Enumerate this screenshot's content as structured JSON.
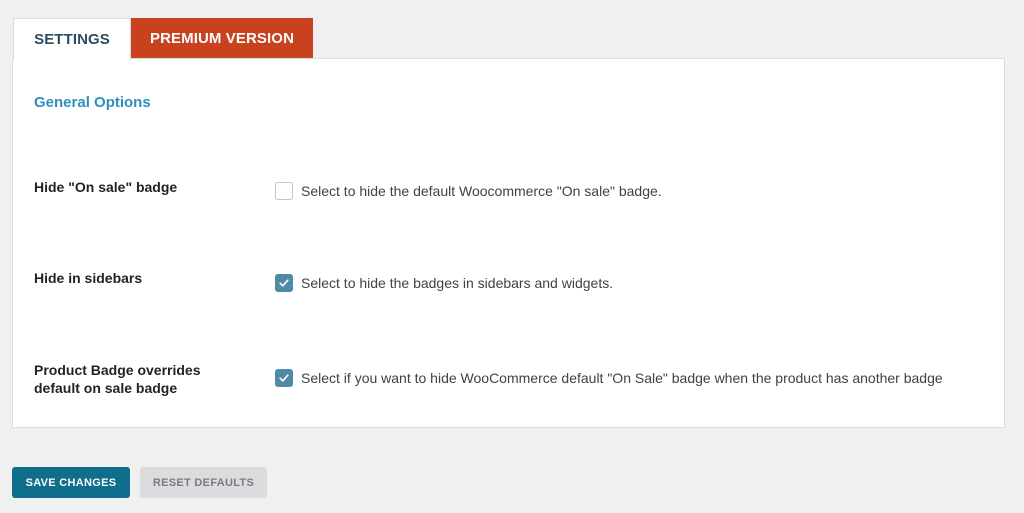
{
  "tabs": [
    {
      "label": "SETTINGS",
      "active": true
    },
    {
      "label": "PREMIUM VERSION",
      "active": false,
      "color": "#c9421f"
    }
  ],
  "section": {
    "title": "General Options"
  },
  "options": [
    {
      "label": "Hide \"On sale\" badge",
      "description": "Select to hide the default Woocommerce \"On sale\" badge.",
      "checked": false
    },
    {
      "label": "Hide in sidebars",
      "description": "Select to hide the badges in sidebars and widgets.",
      "checked": true
    },
    {
      "label_line1": "Product Badge overrides",
      "label_line2": "default on sale badge",
      "description": "Select if you want to hide WooCommerce default \"On Sale\" badge when the product has another badge",
      "checked": true
    }
  ],
  "buttons": {
    "save_label": "SAVE CHANGES",
    "reset_label": "RESET DEFAULTS"
  },
  "colors": {
    "accent": "#2f8fbf",
    "checkbox_checked": "#4f8aa6",
    "primary_button": "#0f6e8c",
    "premium_tab": "#c9421f"
  }
}
